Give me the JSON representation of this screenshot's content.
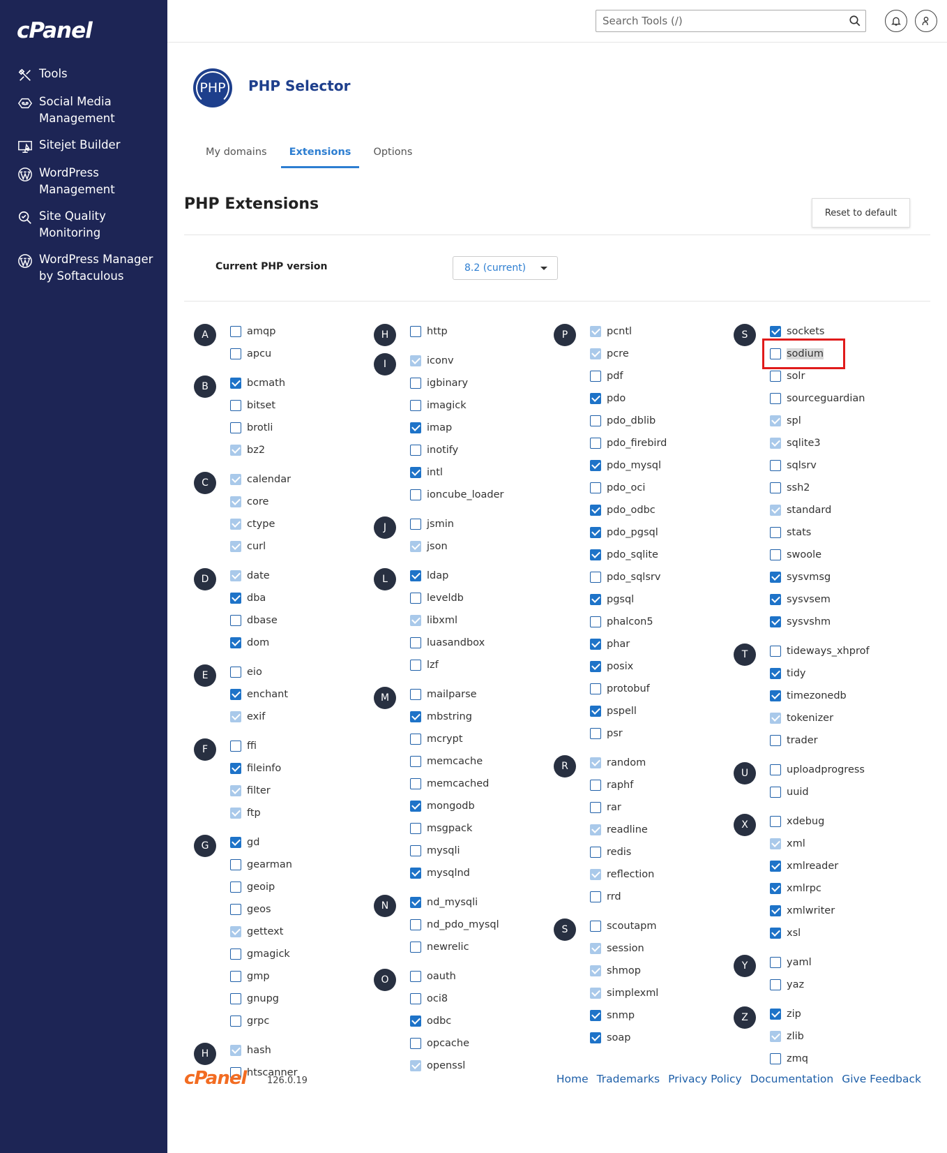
{
  "app": {
    "logo_text": "cPanel",
    "search_placeholder": "Search Tools (/)"
  },
  "sidebar": {
    "items": [
      {
        "label": "Tools",
        "icon": "tools-icon"
      },
      {
        "label": "Social Media Management",
        "icon": "social-media-icon"
      },
      {
        "label": "Sitejet Builder",
        "icon": "sitejet-icon"
      },
      {
        "label": "WordPress Management",
        "icon": "wordpress-icon"
      },
      {
        "label": "Site Quality Monitoring",
        "icon": "site-quality-icon"
      },
      {
        "label": "WordPress Manager by Softaculous",
        "icon": "wordpress-icon"
      }
    ]
  },
  "header": {
    "php_logo_text": "PHP",
    "title": "PHP Selector",
    "tabs": [
      {
        "label": "My domains",
        "active": false
      },
      {
        "label": "Extensions",
        "active": true
      },
      {
        "label": "Options",
        "active": false
      }
    ]
  },
  "extensions_section": {
    "title": "PHP Extensions",
    "reset_label": "Reset to default",
    "version_label": "Current PHP version",
    "version_value": "8.2 (current)"
  },
  "columns": [
    [
      {
        "letter": "A",
        "items": [
          [
            "amqp",
            "off"
          ],
          [
            "apcu",
            "off"
          ]
        ]
      },
      {
        "letter": "B",
        "items": [
          [
            "bcmath",
            "on"
          ],
          [
            "bitset",
            "off"
          ],
          [
            "brotli",
            "off"
          ],
          [
            "bz2",
            "dis"
          ]
        ]
      },
      {
        "letter": "C",
        "items": [
          [
            "calendar",
            "dis"
          ],
          [
            "core",
            "dis"
          ],
          [
            "ctype",
            "dis"
          ],
          [
            "curl",
            "dis"
          ]
        ]
      },
      {
        "letter": "D",
        "items": [
          [
            "date",
            "dis"
          ],
          [
            "dba",
            "on"
          ],
          [
            "dbase",
            "off"
          ],
          [
            "dom",
            "on"
          ]
        ]
      },
      {
        "letter": "E",
        "items": [
          [
            "eio",
            "off"
          ],
          [
            "enchant",
            "on"
          ],
          [
            "exif",
            "dis"
          ]
        ]
      },
      {
        "letter": "F",
        "items": [
          [
            "ffi",
            "off"
          ],
          [
            "fileinfo",
            "on"
          ],
          [
            "filter",
            "dis"
          ],
          [
            "ftp",
            "dis"
          ]
        ]
      },
      {
        "letter": "G",
        "items": [
          [
            "gd",
            "on"
          ],
          [
            "gearman",
            "off"
          ],
          [
            "geoip",
            "off"
          ],
          [
            "geos",
            "off"
          ],
          [
            "gettext",
            "dis"
          ],
          [
            "gmagick",
            "off"
          ],
          [
            "gmp",
            "off"
          ],
          [
            "gnupg",
            "off"
          ],
          [
            "grpc",
            "off"
          ]
        ]
      },
      {
        "letter": "H",
        "items": [
          [
            "hash",
            "dis"
          ],
          [
            "htscanner",
            "off"
          ]
        ]
      }
    ],
    [
      {
        "letter": "H",
        "items": [
          [
            "http",
            "off"
          ]
        ]
      },
      {
        "letter": "I",
        "items": [
          [
            "iconv",
            "dis"
          ],
          [
            "igbinary",
            "off"
          ],
          [
            "imagick",
            "off"
          ],
          [
            "imap",
            "on"
          ],
          [
            "inotify",
            "off"
          ],
          [
            "intl",
            "on"
          ],
          [
            "ioncube_loader",
            "off"
          ]
        ]
      },
      {
        "letter": "J",
        "items": [
          [
            "jsmin",
            "off"
          ],
          [
            "json",
            "dis"
          ]
        ]
      },
      {
        "letter": "L",
        "items": [
          [
            "ldap",
            "on"
          ],
          [
            "leveldb",
            "off"
          ],
          [
            "libxml",
            "dis"
          ],
          [
            "luasandbox",
            "off"
          ],
          [
            "lzf",
            "off"
          ]
        ]
      },
      {
        "letter": "M",
        "items": [
          [
            "mailparse",
            "off"
          ],
          [
            "mbstring",
            "on"
          ],
          [
            "mcrypt",
            "off"
          ],
          [
            "memcache",
            "off"
          ],
          [
            "memcached",
            "off"
          ],
          [
            "mongodb",
            "on"
          ],
          [
            "msgpack",
            "off"
          ],
          [
            "mysqli",
            "off"
          ],
          [
            "mysqlnd",
            "on"
          ]
        ]
      },
      {
        "letter": "N",
        "items": [
          [
            "nd_mysqli",
            "on"
          ],
          [
            "nd_pdo_mysql",
            "off"
          ],
          [
            "newrelic",
            "off"
          ]
        ]
      },
      {
        "letter": "O",
        "items": [
          [
            "oauth",
            "off"
          ],
          [
            "oci8",
            "off"
          ],
          [
            "odbc",
            "on"
          ],
          [
            "opcache",
            "off"
          ],
          [
            "openssl",
            "dis"
          ]
        ]
      }
    ],
    [
      {
        "letter": "P",
        "items": [
          [
            "pcntl",
            "dis"
          ],
          [
            "pcre",
            "dis"
          ],
          [
            "pdf",
            "off"
          ],
          [
            "pdo",
            "on"
          ],
          [
            "pdo_dblib",
            "off"
          ],
          [
            "pdo_firebird",
            "off"
          ],
          [
            "pdo_mysql",
            "on"
          ],
          [
            "pdo_oci",
            "off"
          ],
          [
            "pdo_odbc",
            "on"
          ],
          [
            "pdo_pgsql",
            "on"
          ],
          [
            "pdo_sqlite",
            "on"
          ],
          [
            "pdo_sqlsrv",
            "off"
          ],
          [
            "pgsql",
            "on"
          ],
          [
            "phalcon5",
            "off"
          ],
          [
            "phar",
            "on"
          ],
          [
            "posix",
            "on"
          ],
          [
            "protobuf",
            "off"
          ],
          [
            "pspell",
            "on"
          ],
          [
            "psr",
            "off"
          ]
        ]
      },
      {
        "letter": "R",
        "items": [
          [
            "random",
            "dis"
          ],
          [
            "raphf",
            "off"
          ],
          [
            "rar",
            "off"
          ],
          [
            "readline",
            "dis"
          ],
          [
            "redis",
            "off"
          ],
          [
            "reflection",
            "dis"
          ],
          [
            "rrd",
            "off"
          ]
        ]
      },
      {
        "letter": "S",
        "items": [
          [
            "scoutapm",
            "off"
          ],
          [
            "session",
            "dis"
          ],
          [
            "shmop",
            "dis"
          ],
          [
            "simplexml",
            "dis"
          ],
          [
            "snmp",
            "on"
          ],
          [
            "soap",
            "on"
          ]
        ]
      }
    ],
    [
      {
        "letter": "S",
        "items": [
          [
            "sockets",
            "on"
          ],
          [
            "sodium",
            "off",
            "hl"
          ],
          [
            "solr",
            "off"
          ],
          [
            "sourceguardian",
            "off"
          ],
          [
            "spl",
            "dis"
          ],
          [
            "sqlite3",
            "dis"
          ],
          [
            "sqlsrv",
            "off"
          ],
          [
            "ssh2",
            "off"
          ],
          [
            "standard",
            "dis"
          ],
          [
            "stats",
            "off"
          ],
          [
            "swoole",
            "off"
          ],
          [
            "sysvmsg",
            "on"
          ],
          [
            "sysvsem",
            "on"
          ],
          [
            "sysvshm",
            "on"
          ]
        ]
      },
      {
        "letter": "T",
        "items": [
          [
            "tideways_xhprof",
            "off"
          ],
          [
            "tidy",
            "on"
          ],
          [
            "timezonedb",
            "on"
          ],
          [
            "tokenizer",
            "dis"
          ],
          [
            "trader",
            "off"
          ]
        ]
      },
      {
        "letter": "U",
        "items": [
          [
            "uploadprogress",
            "off"
          ],
          [
            "uuid",
            "off"
          ]
        ]
      },
      {
        "letter": "X",
        "items": [
          [
            "xdebug",
            "off"
          ],
          [
            "xml",
            "dis"
          ],
          [
            "xmlreader",
            "on"
          ],
          [
            "xmlrpc",
            "on"
          ],
          [
            "xmlwriter",
            "on"
          ],
          [
            "xsl",
            "on"
          ]
        ]
      },
      {
        "letter": "Y",
        "items": [
          [
            "yaml",
            "off"
          ],
          [
            "yaz",
            "off"
          ]
        ]
      },
      {
        "letter": "Z",
        "items": [
          [
            "zip",
            "on"
          ],
          [
            "zlib",
            "dis"
          ],
          [
            "zmq",
            "off"
          ]
        ]
      }
    ]
  ],
  "footer": {
    "logo_text": "cPanel",
    "version": "126.0.19",
    "links": [
      "Home",
      "Trademarks",
      "Privacy Policy",
      "Documentation",
      "Give Feedback"
    ]
  }
}
